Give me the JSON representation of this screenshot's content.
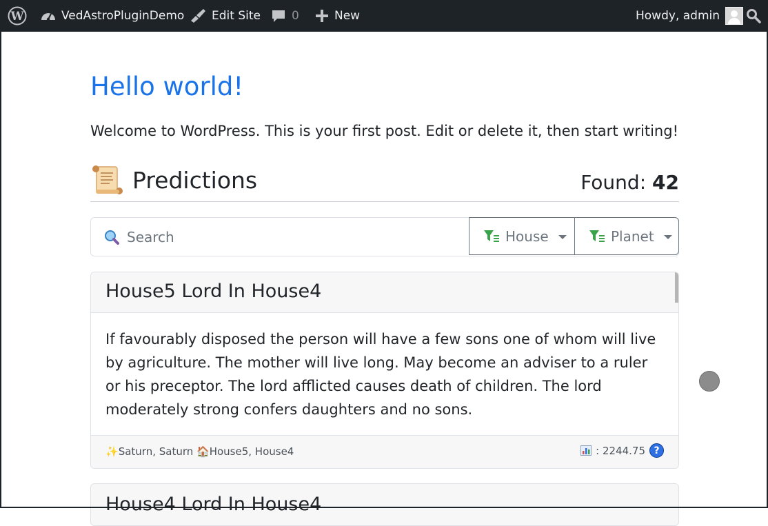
{
  "adminbar": {
    "site_name": "VedAstroPluginDemo",
    "edit_site": "Edit Site",
    "comments_count": "0",
    "new_label": "New",
    "howdy": "Howdy, admin"
  },
  "post": {
    "title": "Hello world!",
    "text": "Welcome to WordPress. This is your first post. Edit or delete it, then start writing!"
  },
  "predictions": {
    "title": "Predictions",
    "found_label": "Found:",
    "found_count": "42",
    "search_placeholder": "Search",
    "filters": {
      "house": "House",
      "planet": "Planet"
    },
    "cards": [
      {
        "title": "House5 Lord In House4",
        "body": "If favourably disposed the person will have a few sons one of whom will live by agriculture. The mother will live long. May become an adviser to a ruler or his preceptor. The lord afflicted causes death of children. The lord moderately strong confers daughters and no sons.",
        "planets": "Saturn, Saturn",
        "houses": "House5, House4",
        "score": ": 2244.75"
      },
      {
        "title": "House4 Lord In House4"
      }
    ]
  },
  "colors": {
    "adminbar_bg": "#1d2327",
    "title_blue": "#1a73e8",
    "help_blue": "#2f6fe4"
  }
}
